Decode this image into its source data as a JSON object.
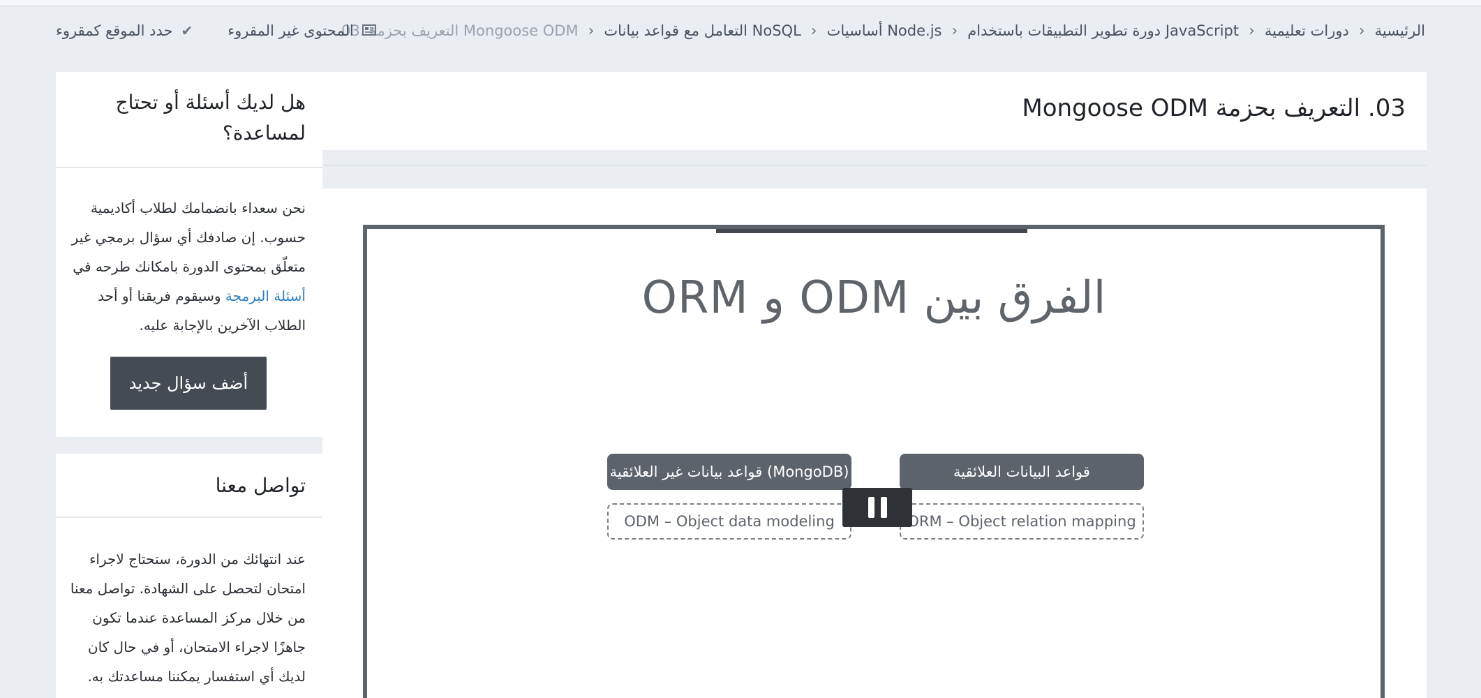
{
  "breadcrumb": {
    "items": [
      "الرئيسية",
      "دورات تعليمية",
      "دورة تطوير التطبيقات باستخدام JavaScript",
      "أساسيات Node.js",
      "التعامل مع قواعد بيانات NoSQL"
    ],
    "current": "03. التعريف بحزمة Mongoose ODM",
    "separator": "›"
  },
  "actions": {
    "unread_label": "المحتوى غير المقروء",
    "unread_icon": "newspaper-icon",
    "mark_read_label": "حدد الموقع كمقروء",
    "mark_read_icon": "check-icon"
  },
  "lesson": {
    "title": "03. التعريف بحزمة Mongoose ODM"
  },
  "video": {
    "slide_title": "الفرق بين ODM و ORM",
    "relational_label": "قواعد البيانات العلائقية",
    "nonrelational_label": "قواعد بيانات غير العلائقية (MongoDB)",
    "orm_label": "ORM – Object relation mapping",
    "odm_label": "ODM – Object data modeling",
    "control": "pause-icon"
  },
  "sidebar": {
    "help": {
      "title": "هل لديك أسئلة أو تحتاج لمساعدة؟",
      "text_before_link": "نحن سعداء بانضمامك لطلاب أكاديمية حسوب. إن صادفك أي سؤال برمجي غير متعلّق بمحتوى الدورة بامكانك طرحه في",
      "link_label": "أسئلة البرمجة",
      "text_after_link": "وسيقوم فريقنا أو أحد الطلاب الآخرين بالإجابة عليه.",
      "button_label": "أضف سؤال جديد"
    },
    "contact": {
      "title": "تواصل معنا",
      "text": "عند انتهائك من الدورة، ستحتاج لاجراء امتحان لتحصل على الشهادة. تواصل معنا من خلال مركز المساعدة عندما تكون جاهزًا لاجراء الامتحان، أو في حال كان لديك أي استفسار يمكننا مساعدتك به."
    }
  },
  "colors": {
    "page_bg": "#eaeef3",
    "slide_box": "#5d636b",
    "button_bg": "#454b53",
    "link": "#2c7fbf"
  }
}
